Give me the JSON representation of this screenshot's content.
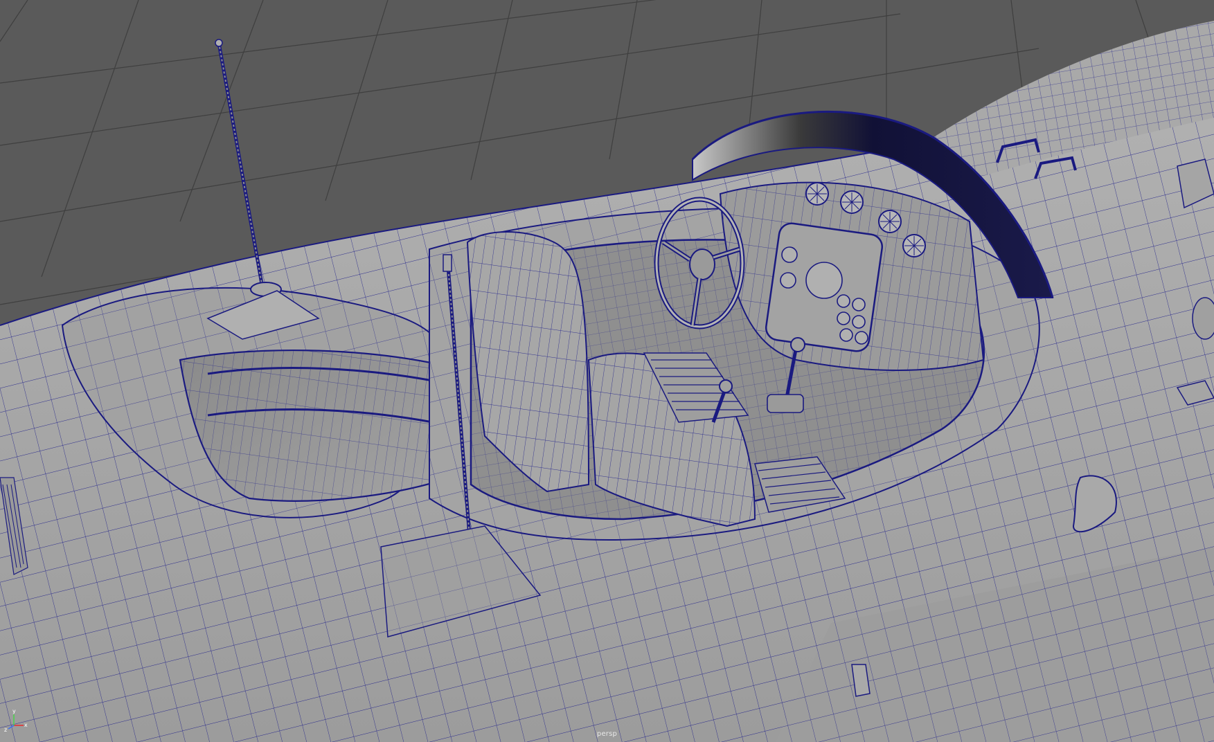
{
  "viewport": {
    "camera_name": "persp",
    "display_mode": "wireframe-on-shaded",
    "wire_color": "#1a1a8c",
    "shaded_color": "#a6a6a6",
    "background_color": "#5a5a5a",
    "grid_color": "#3e3e3e"
  },
  "axis_gizmo": {
    "x_label": "x",
    "y_label": "y",
    "z_label": "z",
    "x_color": "#e53030",
    "y_color": "#4fd14f",
    "z_color": "#3a6cf0"
  },
  "scene": {
    "subject": "car-model",
    "objects": [
      "car-body",
      "cockpit",
      "windscreen",
      "steering-wheel",
      "dashboard",
      "driver-seat",
      "rear-seat",
      "gear-lever",
      "handbrake-lever",
      "antenna-left",
      "antenna-center",
      "side-vents",
      "door-handle"
    ]
  }
}
